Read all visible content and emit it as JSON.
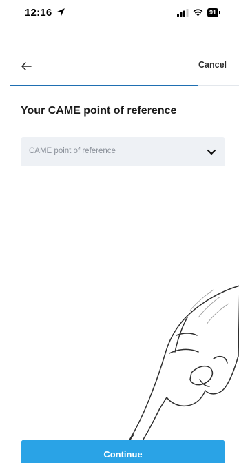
{
  "status_bar": {
    "time": "12:16",
    "battery": "91"
  },
  "nav": {
    "cancel_label": "Cancel"
  },
  "progress": {
    "fraction": 0.82,
    "accent": "#1f6fb2"
  },
  "page": {
    "title": "Your CAME point of reference"
  },
  "reference_select": {
    "placeholder": "CAME point of reference",
    "icon": "chevron-down-icon"
  },
  "continue_button": {
    "label": "Continue",
    "color": "#2aa3e6"
  }
}
